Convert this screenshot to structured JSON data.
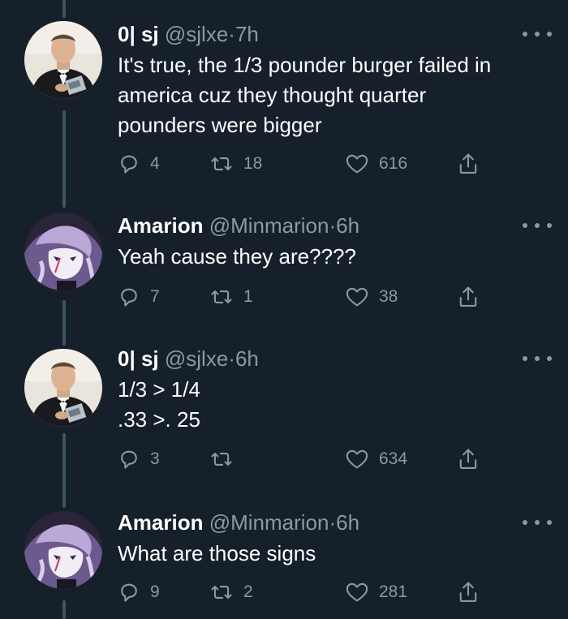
{
  "tweets": [
    {
      "author": {
        "name": "0| sj",
        "handle": "@sjlxe"
      },
      "separator": "·",
      "time": "7h",
      "lines": [
        "It's true, the 1/3 pounder burger failed in",
        "america cuz they thought quarter",
        "pounders were bigger"
      ],
      "stats": {
        "replies": "4",
        "retweets": "18",
        "likes": "616"
      },
      "avatar_icon": "person-in-tuxedo-avatar"
    },
    {
      "author": {
        "name": "Amarion",
        "handle": "@Minmarion"
      },
      "separator": "·",
      "time": "6h",
      "lines": [
        "Yeah cause they are????"
      ],
      "stats": {
        "replies": "7",
        "retweets": "1",
        "likes": "38"
      },
      "avatar_icon": "anime-character-avatar"
    },
    {
      "author": {
        "name": "0| sj",
        "handle": "@sjlxe"
      },
      "separator": "·",
      "time": "6h",
      "lines": [
        "1/3 > 1/4",
        ".33 >. 25"
      ],
      "stats": {
        "replies": "3",
        "retweets": "",
        "likes": "634"
      },
      "avatar_icon": "person-in-tuxedo-avatar"
    },
    {
      "author": {
        "name": "Amarion",
        "handle": "@Minmarion"
      },
      "separator": "·",
      "time": "6h",
      "lines": [
        "What are those signs"
      ],
      "stats": {
        "replies": "9",
        "retweets": "2",
        "likes": "281"
      },
      "avatar_icon": "anime-character-avatar"
    }
  ],
  "colors": {
    "background": "#15202b",
    "primary_text": "#ffffff",
    "secondary_text": "#8b98a5",
    "thread_line": "#3d5466"
  },
  "icons": {
    "more": "more-horizontal-icon",
    "reply": "reply-bubble-icon",
    "retweet": "retweet-icon",
    "like": "heart-icon",
    "share": "share-upload-icon"
  }
}
